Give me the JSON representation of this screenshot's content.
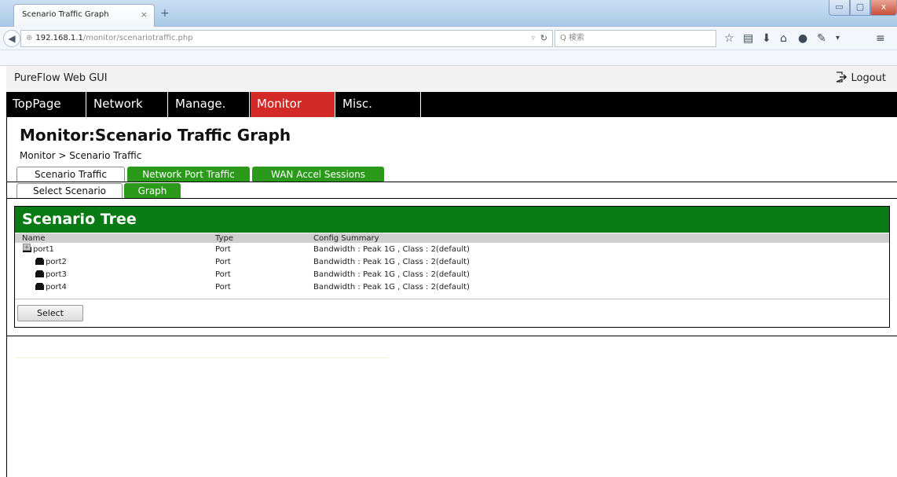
{
  "browser": {
    "tab_title": "Scenario Traffic Graph",
    "tab_close": "×",
    "new_tab": "+",
    "url_host": "192.168.1.1",
    "url_path": "/monitor/scenariotraffic.php",
    "search_placeholder": "Q 検索",
    "window_controls": {
      "minimize": "▭",
      "maximize": "▢",
      "close": "x"
    }
  },
  "app": {
    "title": "PureFlow Web GUI",
    "logout_label": "Logout"
  },
  "menu": {
    "items": [
      {
        "label": "TopPage"
      },
      {
        "label": "Network"
      },
      {
        "label": "Manage."
      },
      {
        "label": "Monitor",
        "active": true
      },
      {
        "label": "Misc."
      }
    ]
  },
  "page": {
    "heading": "Monitor:Scenario Traffic Graph",
    "breadcrumb": "Monitor > Scenario Traffic"
  },
  "tabs": {
    "primary": [
      "Scenario Traffic",
      "Network Port Traffic",
      "WAN Accel Sessions"
    ],
    "secondary": [
      "Select Scenario",
      "Graph"
    ]
  },
  "tree": {
    "title": "Scenario Tree",
    "columns": [
      "Name",
      "Type",
      "Config Summary"
    ],
    "expander_symbol": "+",
    "rows": [
      {
        "name": "port1",
        "type": "Port",
        "summary": "Bandwidth : Peak 1G , Class : 2(default)"
      },
      {
        "name": "port2",
        "type": "Port",
        "summary": "Bandwidth : Peak 1G , Class : 2(default)"
      },
      {
        "name": "port3",
        "type": "Port",
        "summary": "Bandwidth : Peak 1G , Class : 2(default)"
      },
      {
        "name": "port4",
        "type": "Port",
        "summary": "Bandwidth : Peak 1G , Class : 2(default)"
      }
    ],
    "select_button": "Select"
  },
  "colors": {
    "menu_bg": "#000000",
    "menu_active": "#d32a27",
    "tab_green": "#2b9a1a",
    "tree_header_green": "#0a7a14"
  },
  "icons": [
    "globe-icon",
    "reload-icon",
    "star-icon",
    "bookmark-icon",
    "download-icon",
    "home-icon",
    "chat-icon",
    "menu-icon",
    "logout-icon",
    "port-icon"
  ]
}
